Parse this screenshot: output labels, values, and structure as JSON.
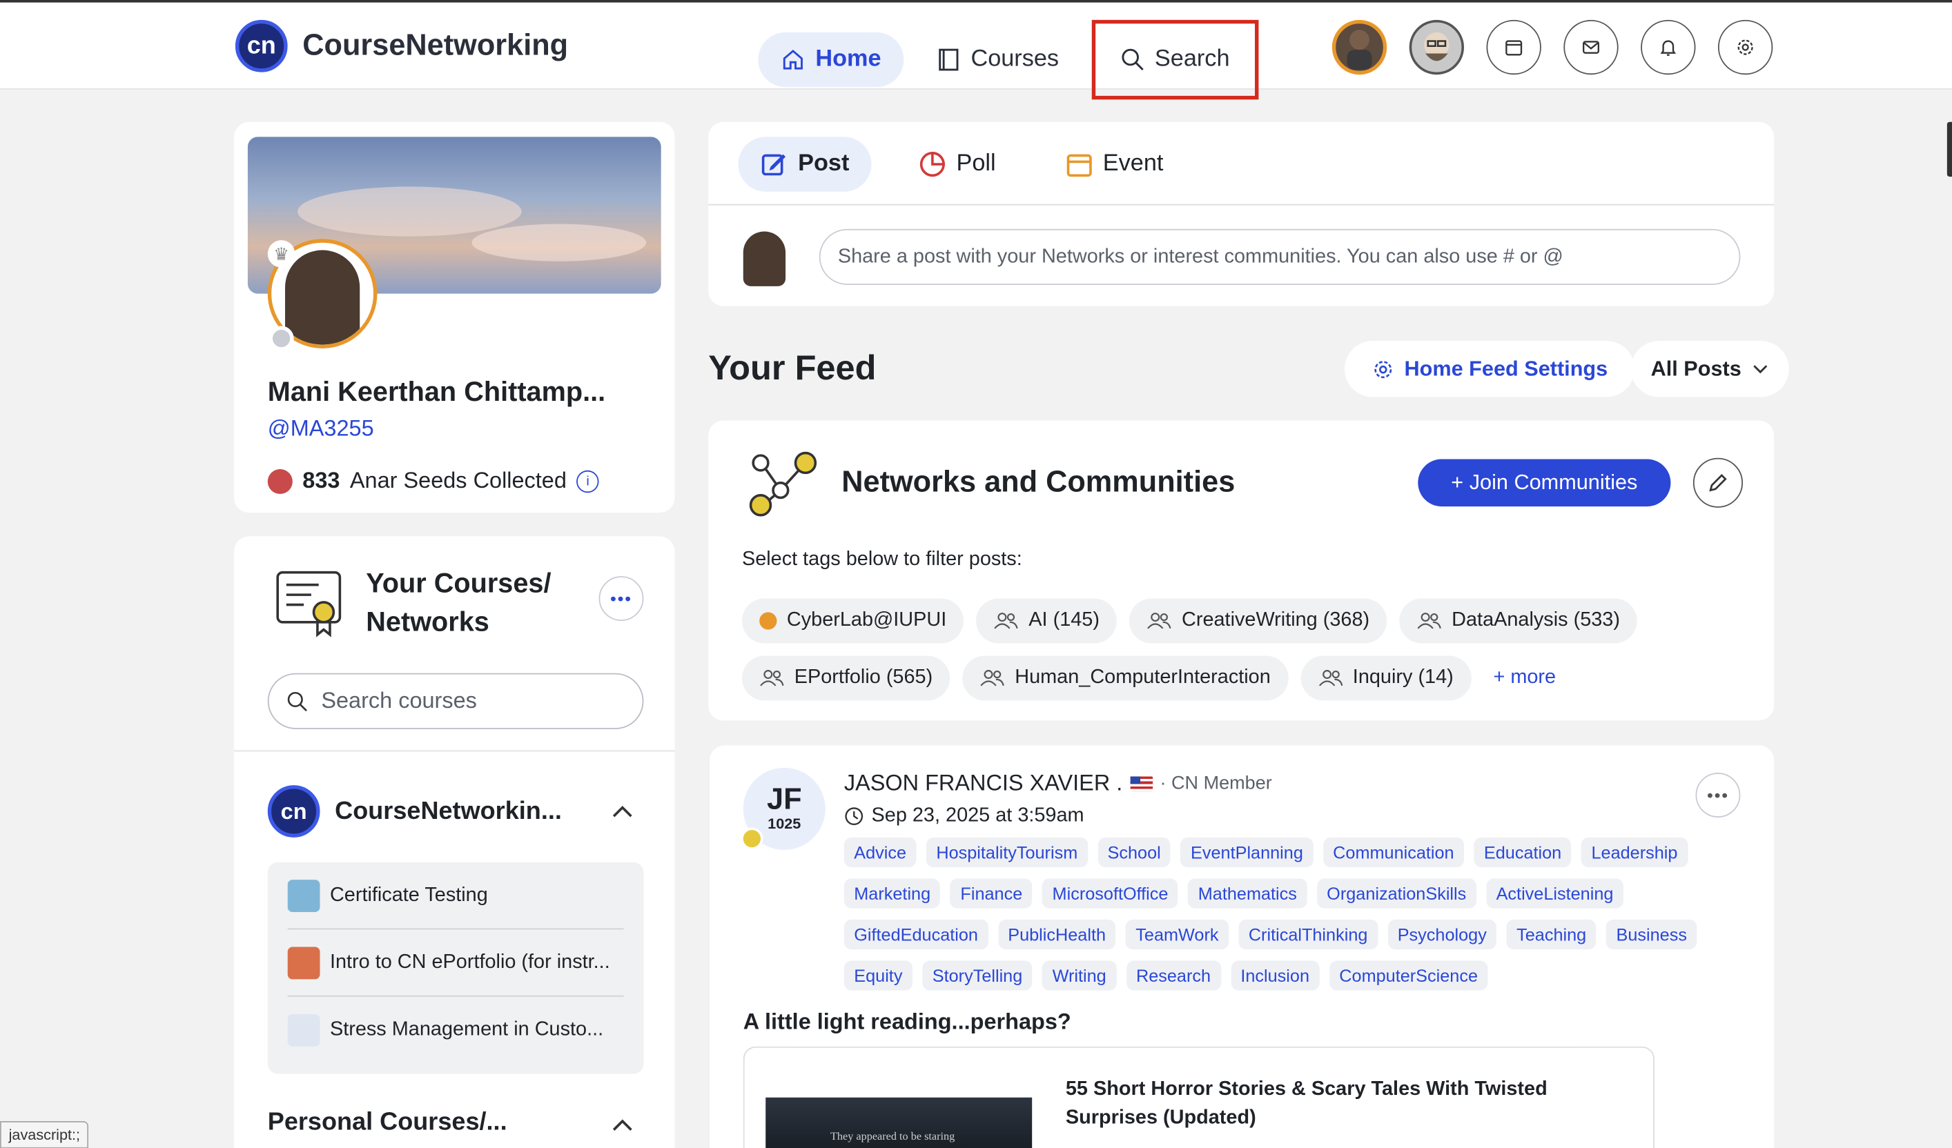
{
  "app": {
    "name": "CourseNetworking",
    "logo_text": "cn"
  },
  "nav": {
    "home": "Home",
    "courses": "Courses",
    "search": "Search"
  },
  "profile": {
    "name": "Mani Keerthan Chittamp...",
    "handle": "@MA3255",
    "seeds_count": "833",
    "seeds_label": "Anar Seeds Collected"
  },
  "courses_panel": {
    "title": "Your Courses/ Networks",
    "search_placeholder": "Search courses",
    "org_name": "CourseNetworkin...",
    "items": [
      {
        "label": "Certificate Testing"
      },
      {
        "label": "Intro to CN ePortfolio (for instr..."
      },
      {
        "label": "Stress Management in Custo..."
      }
    ],
    "personal_title": "Personal Courses/..."
  },
  "composer": {
    "tabs": [
      {
        "label": "Post"
      },
      {
        "label": "Poll"
      },
      {
        "label": "Event"
      }
    ],
    "placeholder": "Share a post with your Networks or interest communities. You can also use # or @"
  },
  "feed": {
    "title": "Your Feed",
    "settings_label": "Home Feed Settings",
    "filter_label": "All Posts"
  },
  "networks": {
    "title": "Networks and Communities",
    "join_label": "+ Join Communities",
    "select_label": "Select tags below to filter posts:",
    "tags": [
      {
        "label": "CyberLab@IUPUI"
      },
      {
        "label": "AI (145)"
      },
      {
        "label": "CreativeWriting (368)"
      },
      {
        "label": "DataAnalysis (533)"
      },
      {
        "label": "EPortfolio (565)"
      },
      {
        "label": "Human_ComputerInteraction"
      },
      {
        "label": "Inquiry (14)"
      }
    ],
    "more_label": "+ more"
  },
  "post": {
    "initials": "JF",
    "points": "1025",
    "author": "JASON FRANCIS XAVIER .",
    "role": "· CN Member",
    "time": "Sep 23, 2025 at 3:59am",
    "tags": [
      "Advice",
      "HospitalityTourism",
      "School",
      "EventPlanning",
      "Communication",
      "Education",
      "Leadership",
      "Marketing",
      "Finance",
      "MicrosoftOffice",
      "Mathematics",
      "OrganizationSkills",
      "ActiveListening",
      "GiftedEducation",
      "PublicHealth",
      "TeamWork",
      "CriticalThinking",
      "Psychology",
      "Teaching",
      "Business",
      "Equity",
      "StoryTelling",
      "Writing",
      "Research",
      "Inclusion",
      "ComputerScience"
    ],
    "heading": "A little light reading...perhaps?",
    "link_title": "55 Short Horror Stories & Scary Tales With Twisted Surprises (Updated)",
    "thumb_text": "They appeared to be staring"
  },
  "status_bar": "javascript:;",
  "colors": {
    "accent": "#2a47d6",
    "highlight_box": "#d42a1c",
    "avatar_ring": "#e8972a"
  }
}
